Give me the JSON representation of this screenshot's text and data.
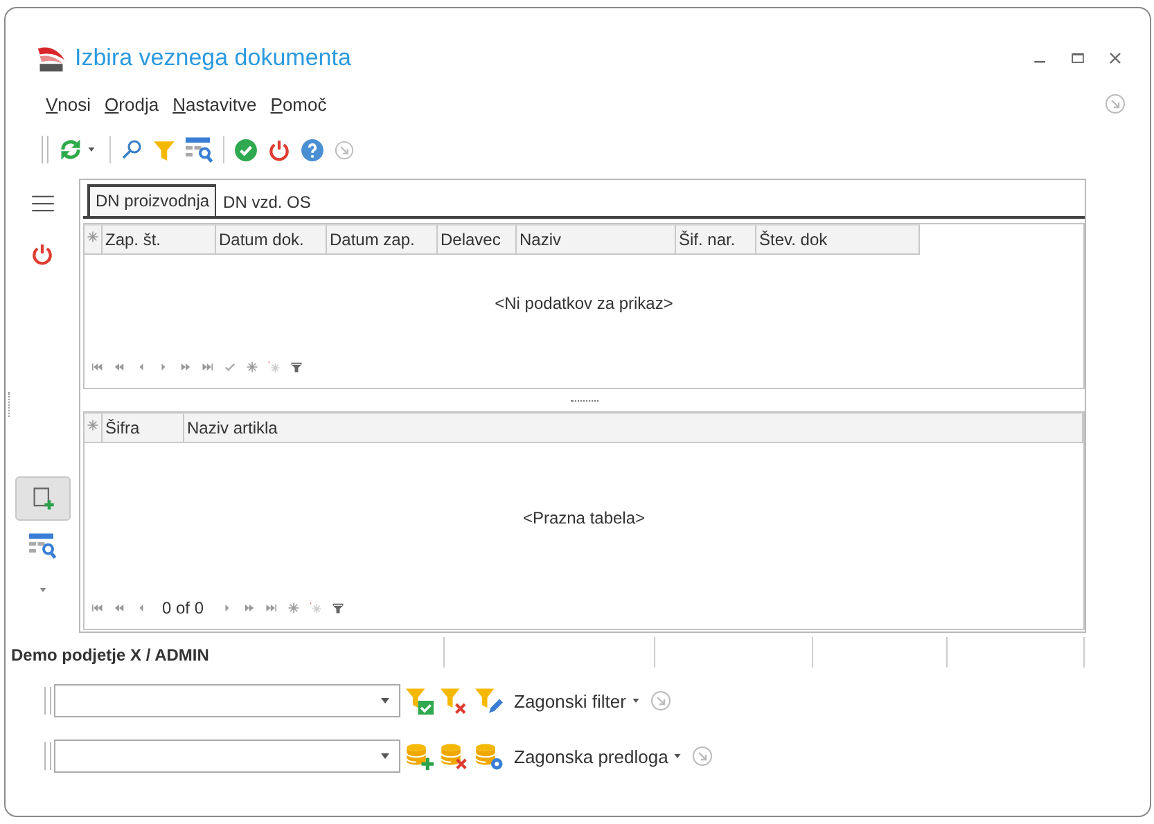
{
  "window": {
    "title": "Izbira veznega dokumenta"
  },
  "menu": [
    {
      "label": "Vnosi"
    },
    {
      "label": "Orodja"
    },
    {
      "label": "Nastavitve"
    },
    {
      "label": "Pomoč"
    }
  ],
  "tabs": [
    {
      "label": "DN proizvodnja",
      "selected": true
    },
    {
      "label": "DN vzd. OS",
      "selected": false
    }
  ],
  "grids": [
    {
      "columns": [
        "Zap. št.",
        "Datum dok.",
        "Datum zap.",
        "Delavec",
        "Naziv",
        "Šif. nar.",
        "Štev. dok"
      ],
      "empty_text": "<Ni podatkov za prikaz>"
    },
    {
      "columns": [
        "Šifra",
        "Naziv artikla"
      ],
      "empty_text": "<Prazna tabela>",
      "navigator_text": "0 of 0"
    }
  ],
  "status_bar": {
    "text": "Demo podjetje X / ADMIN"
  },
  "filter_rows": [
    {
      "kind": "filter",
      "label": "Zagonski filter"
    },
    {
      "kind": "template",
      "label": "Zagonska predloga"
    }
  ]
}
